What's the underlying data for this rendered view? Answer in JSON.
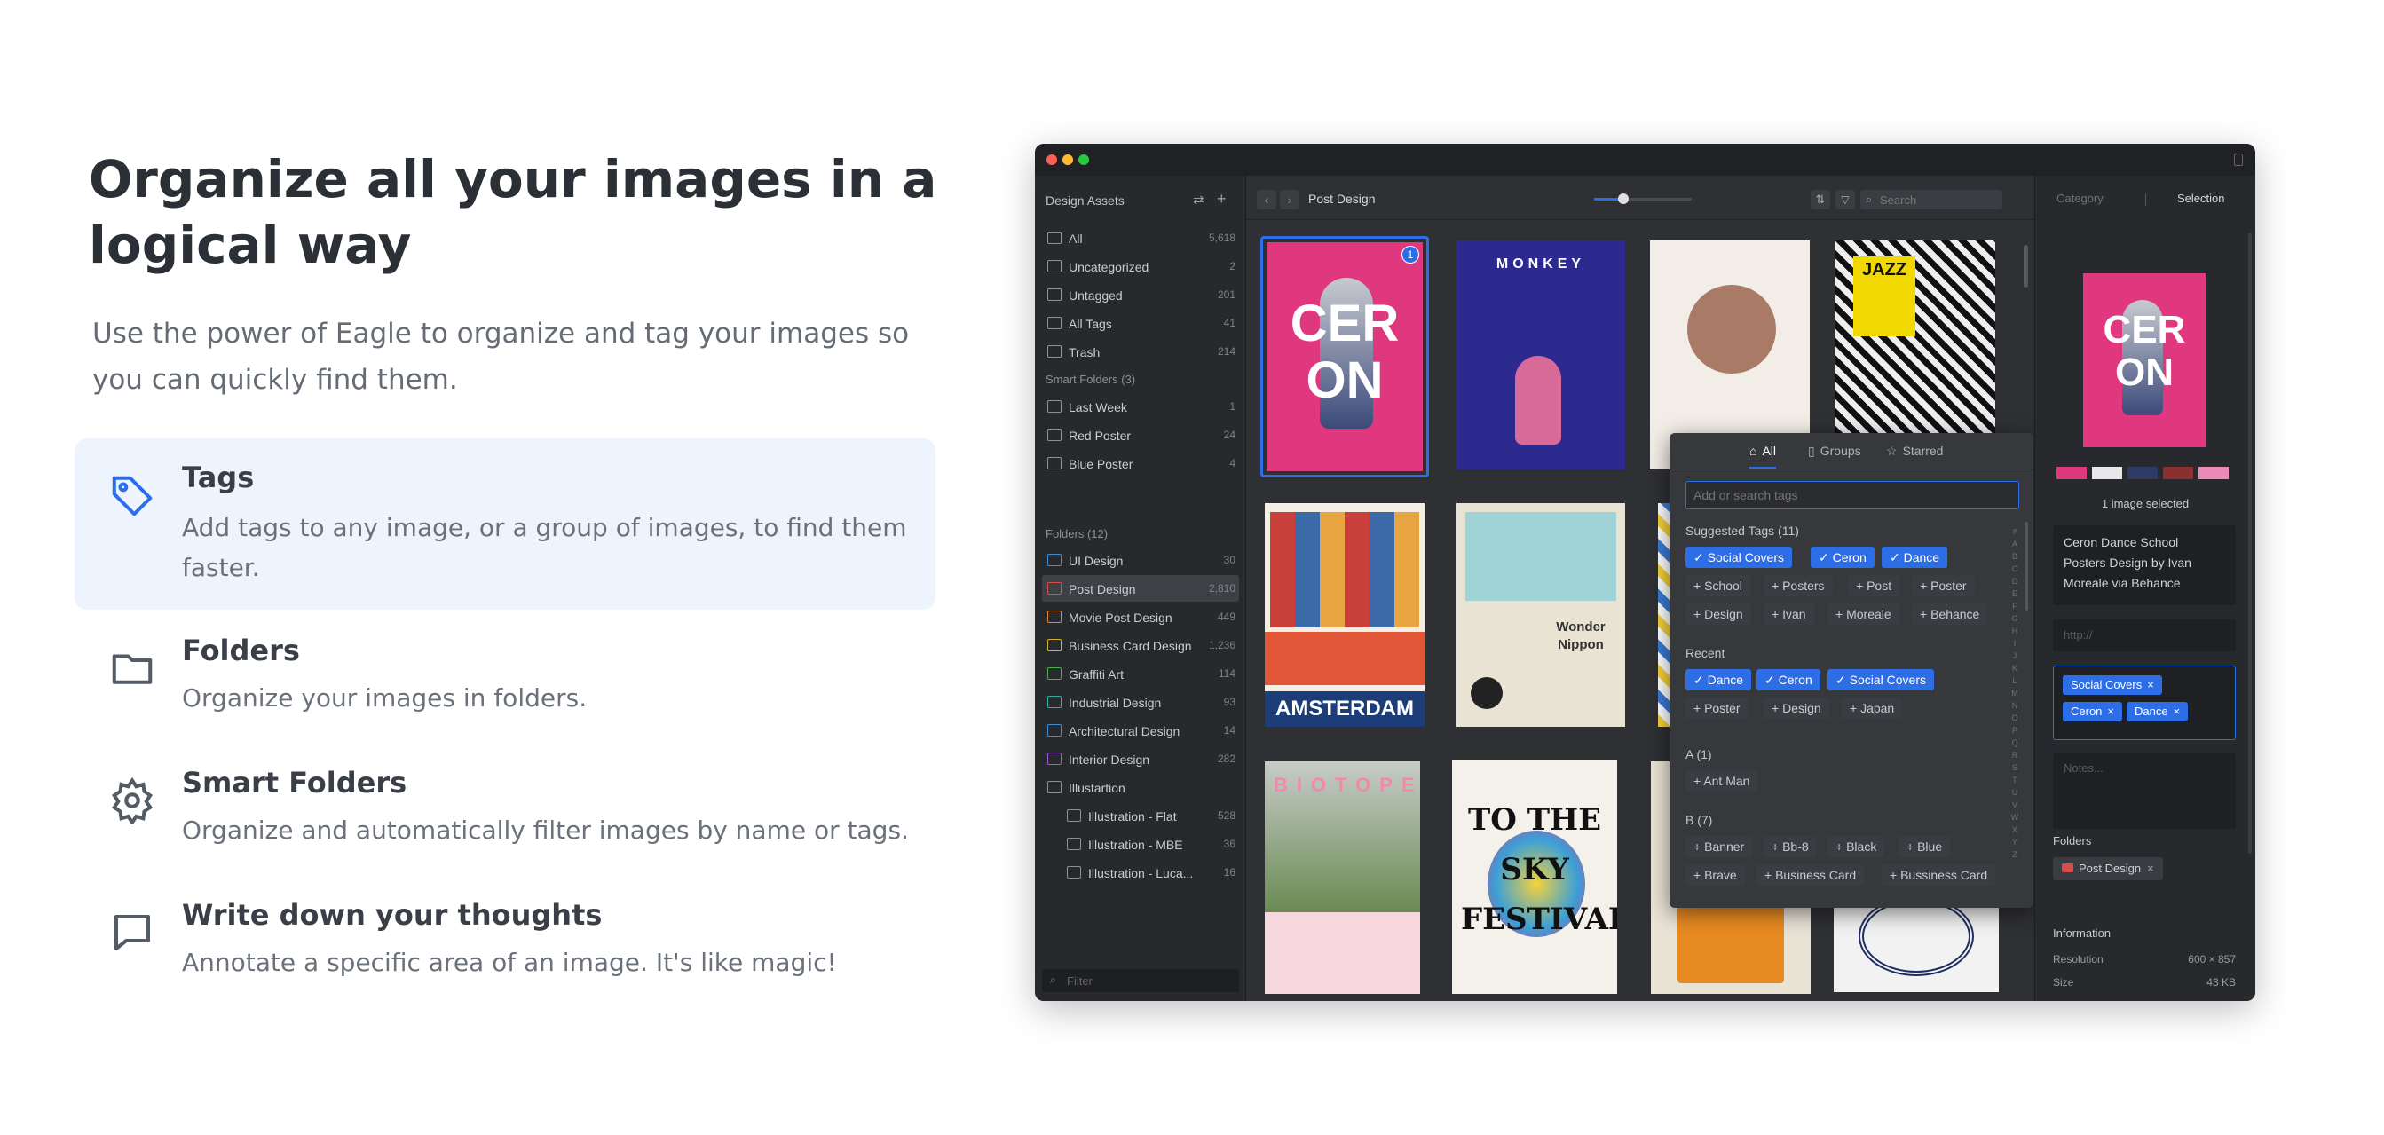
{
  "hero": {
    "title": "Organize all your images in a logical way",
    "subtitle": "Use the power of Eagle to organize and tag your images so you can quickly find them."
  },
  "features": [
    {
      "title": "Tags",
      "desc": "Add tags to any image, or a group of images, to find them faster.",
      "icon": "tag-icon",
      "active": true
    },
    {
      "title": "Folders",
      "desc": "Organize your images in folders.",
      "icon": "folder-icon",
      "active": false
    },
    {
      "title": "Smart Folders",
      "desc": "Organize and automatically filter images by name or tags.",
      "icon": "gear-icon",
      "active": false
    },
    {
      "title": "Write down your thoughts",
      "desc": "Annotate a specific area of an image. It's like magic!",
      "icon": "comment-icon",
      "active": false
    }
  ],
  "app": {
    "library": "Design Assets",
    "nav": [
      {
        "label": "All",
        "count": "5,618"
      },
      {
        "label": "Uncategorized",
        "count": "2"
      },
      {
        "label": "Untagged",
        "count": "201"
      },
      {
        "label": "All Tags",
        "count": "41"
      },
      {
        "label": "Trash",
        "count": "214"
      }
    ],
    "smart_folders_label": "Smart Folders (3)",
    "smart_folders": [
      {
        "label": "Last Week",
        "count": "1"
      },
      {
        "label": "Red Poster",
        "count": "24"
      },
      {
        "label": "Blue Poster",
        "count": "4"
      }
    ],
    "folders_label": "Folders (12)",
    "folders": [
      {
        "label": "UI Design",
        "count": "30",
        "color": "#3a8fd6"
      },
      {
        "label": "Post Design",
        "count": "2,810",
        "color": "#d84c4c",
        "selected": true
      },
      {
        "label": "Movie Post Design",
        "count": "449",
        "color": "#e08a2e"
      },
      {
        "label": "Business Card Design",
        "count": "1,236",
        "color": "#d6b02e"
      },
      {
        "label": "Graffiti Art",
        "count": "114",
        "color": "#4caf50"
      },
      {
        "label": "Industrial Design",
        "count": "93",
        "color": "#2ab3a6"
      },
      {
        "label": "Architectural Design",
        "count": "14",
        "color": "#3a8fd6"
      },
      {
        "label": "Interior Design",
        "count": "282",
        "color": "#9c5ad6"
      },
      {
        "label": "Illustartion",
        "count": "",
        "color": "#8e9197"
      },
      {
        "label": "Illustration - Flat",
        "count": "528",
        "color": "#8e9197",
        "sub": true
      },
      {
        "label": "Illustration - MBE",
        "count": "36",
        "color": "#8e9197",
        "sub": true
      },
      {
        "label": "Illustration - Luca...",
        "count": "16",
        "color": "#8e9197",
        "sub": true
      }
    ],
    "filter_placeholder": "Filter",
    "toolbar_title": "Post Design",
    "zoom_level": 0.3,
    "search_placeholder": "Search",
    "thumb_texts": {
      "ceron": "CER ON",
      "monkey": "MONKEY",
      "amsterdam": "AMSTERDAM",
      "wonder": "Wonder Nippon",
      "sky": "TO THE SKY FESTIVAL",
      "biotope": "BIOTOPE",
      "jazz": "JAZZ",
      "badge": "1"
    },
    "popup": {
      "tabs": [
        "All",
        "Groups",
        "Starred"
      ],
      "placeholder": "Add or search tags",
      "suggested_label": "Suggested Tags (11)",
      "suggested": [
        {
          "label": "Social Covers",
          "on": true
        },
        {
          "label": "Ceron",
          "on": true
        },
        {
          "label": "Dance",
          "on": true
        },
        {
          "label": "School",
          "on": false
        },
        {
          "label": "Posters",
          "on": false
        },
        {
          "label": "Post",
          "on": false
        },
        {
          "label": "Poster",
          "on": false
        },
        {
          "label": "Design",
          "on": false
        },
        {
          "label": "Ivan",
          "on": false
        },
        {
          "label": "Moreale",
          "on": false
        },
        {
          "label": "Behance",
          "on": false
        }
      ],
      "recent_label": "Recent",
      "recent": [
        {
          "label": "Dance",
          "on": true
        },
        {
          "label": "Ceron",
          "on": true
        },
        {
          "label": "Social Covers",
          "on": true
        },
        {
          "label": "Poster",
          "on": false
        },
        {
          "label": "Design",
          "on": false
        },
        {
          "label": "Japan",
          "on": false
        }
      ],
      "a_label": "A (1)",
      "a_tags": [
        "Ant Man"
      ],
      "b_label": "B (7)",
      "b_tags": [
        "Banner",
        "Bb-8",
        "Black",
        "Blue",
        "Brave",
        "Business Card",
        "Bussiness Card"
      ],
      "alphabet": "#ABCDEFGHIJKLMNOPQRSTUVWXYZ"
    },
    "right": {
      "tab_category": "Category",
      "tab_selection": "Selection",
      "selected_text": "1 image selected",
      "palette": [
        "#e0387f",
        "#e8e8ea",
        "#2c3a64",
        "#8a3030",
        "#ea8ab6"
      ],
      "description_lines": [
        "Ceron Dance School",
        "Posters Design by Ivan",
        "Moreale via Behance"
      ],
      "url_placeholder": "http://",
      "tags": [
        "Social Covers",
        "Ceron",
        "Dance"
      ],
      "notes_placeholder": "Notes...",
      "folders_label": "Folders",
      "folder_chip": "Post Design",
      "info_label": "Information",
      "resolution_label": "Resolution",
      "resolution_value": "600 × 857",
      "size_label": "Size",
      "size_value": "43 KB"
    }
  }
}
